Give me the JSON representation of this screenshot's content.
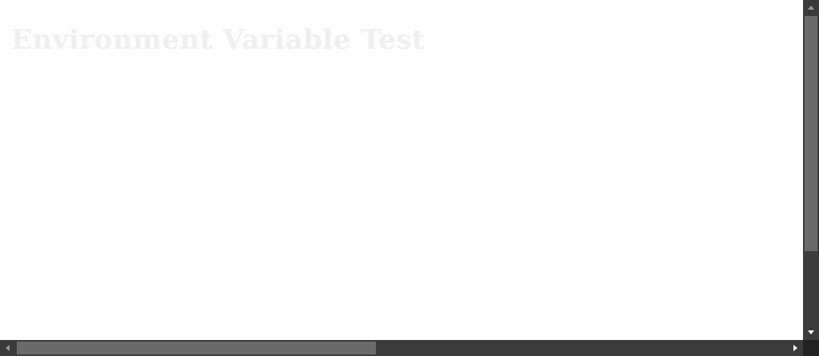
{
  "page": {
    "title": "Environment Variable Test",
    "subtitle": "",
    "lines": [
      "",
      "",
      "",
      "",
      "",
      ""
    ]
  },
  "scrollbars": {
    "vertical_thumb_fraction": 0.72,
    "horizontal_thumb_fraction": 0.46
  },
  "colors": {
    "scrollbar_track": "#3b3b3b",
    "scrollbar_thumb": "#6a6a6a",
    "scrollbar_corner": "#232323",
    "page_background": "#fefefe",
    "faint_text": "#efefef"
  },
  "icons": {
    "scroll_up": "triangle-up-icon",
    "scroll_down": "triangle-down-icon",
    "scroll_left": "triangle-left-icon",
    "scroll_right": "triangle-right-icon"
  }
}
